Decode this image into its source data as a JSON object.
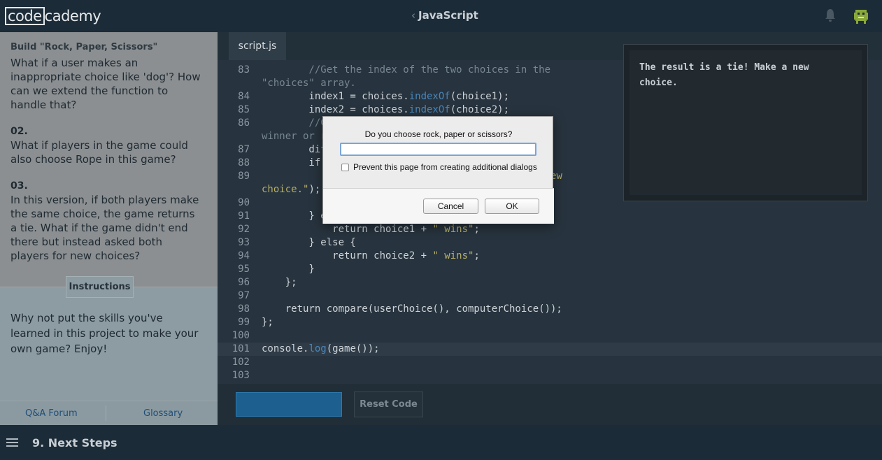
{
  "topbar": {
    "logo_part1": "code",
    "logo_part2": "cademy",
    "breadcrumb": "JavaScript"
  },
  "lesson": {
    "title": "Build \"Rock, Paper, Scissors\"",
    "intro": "What if a user makes an inappropriate choice like 'dog'? How can we extend the function to handle that?",
    "items": [
      {
        "num": "02.",
        "text": "What if players in the game could also choose Rope in this game?"
      },
      {
        "num": "03.",
        "text": "In this version, if both players make the same choice, the game returns a tie. What if the game didn't end there but instead asked both players for new choices?"
      }
    ],
    "instructions_tab": "Instructions",
    "instructions_text": "Why not put the skills you've learned in this project to make your own game? Enjoy!",
    "footer_links": [
      "Q&A Forum",
      "Glossary"
    ]
  },
  "editor": {
    "file_tab": "script.js",
    "reset_label": "Reset Code"
  },
  "code_lines": [
    {
      "n": "83",
      "parts": [
        [
          "cm",
          "        //Get the index of the two choices in the"
        ]
      ]
    },
    {
      "n": "",
      "parts": [
        [
          "cm",
          "\"choices\" array."
        ]
      ]
    },
    {
      "n": "84",
      "parts": [
        [
          "kw",
          "        index1 = choices."
        ],
        [
          "fn",
          "indexOf"
        ],
        [
          "kw",
          "(choice1);"
        ]
      ]
    },
    {
      "n": "85",
      "parts": [
        [
          "kw",
          "        index2 = choices."
        ],
        [
          "fn",
          "indexOf"
        ],
        [
          "kw",
          "(choice2);"
        ]
      ]
    },
    {
      "n": "86",
      "parts": [
        [
          "cm",
          "        //Check the difference to determine the"
        ]
      ]
    },
    {
      "n": "",
      "parts": [
        [
          "cm",
          "winner or result"
        ]
      ]
    },
    {
      "n": "87",
      "parts": [
        [
          "kw",
          "        dif = index2 - index1;"
        ]
      ]
    },
    {
      "n": "88",
      "parts": [
        [
          "kw",
          "        if(dif === 0) {"
        ]
      ]
    },
    {
      "n": "89",
      "parts": [
        [
          "kw",
          "            return "
        ],
        [
          "st",
          "\"The result is a tie! Make a new"
        ]
      ]
    },
    {
      "n": "",
      "parts": [
        [
          "st",
          "choice.\""
        ],
        [
          "kw",
          ");"
        ]
      ]
    },
    {
      "n": "90",
      "parts": [
        [
          "kw",
          "        "
        ]
      ]
    },
    {
      "n": "91",
      "parts": [
        [
          "kw",
          "        } else if (dif < 0) {"
        ]
      ]
    },
    {
      "n": "92",
      "parts": [
        [
          "kw",
          "            return choice1 + "
        ],
        [
          "st",
          "\" wins\""
        ],
        [
          "kw",
          ";"
        ]
      ]
    },
    {
      "n": "93",
      "parts": [
        [
          "kw",
          "        } else {"
        ]
      ]
    },
    {
      "n": "94",
      "parts": [
        [
          "kw",
          "            return choice2 + "
        ],
        [
          "st",
          "\" wins\""
        ],
        [
          "kw",
          ";"
        ]
      ]
    },
    {
      "n": "95",
      "parts": [
        [
          "kw",
          "        }"
        ]
      ]
    },
    {
      "n": "96",
      "parts": [
        [
          "kw",
          "    };"
        ]
      ]
    },
    {
      "n": "97",
      "parts": [
        [
          "kw",
          ""
        ]
      ]
    },
    {
      "n": "98",
      "parts": [
        [
          "kw",
          "    return compare(userChoice(), computerChoice());"
        ]
      ]
    },
    {
      "n": "99",
      "parts": [
        [
          "kw",
          "};"
        ]
      ]
    },
    {
      "n": "100",
      "parts": [
        [
          "kw",
          ""
        ]
      ]
    },
    {
      "n": "101",
      "parts": [
        [
          "kw",
          "console."
        ],
        [
          "fn",
          "log"
        ],
        [
          "kw",
          "(game());"
        ]
      ]
    },
    {
      "n": "102",
      "parts": [
        [
          "kw",
          ""
        ]
      ]
    },
    {
      "n": "103",
      "parts": [
        [
          "kw",
          ""
        ]
      ]
    }
  ],
  "console_output": "The result is a tie! Make a new choice.",
  "footer": {
    "step": "9. Next Steps"
  },
  "dialog": {
    "message": "Do you choose rock, paper or scissors?",
    "input_value": "",
    "checkbox_label": "Prevent this page from creating additional dialogs",
    "cancel_label": "Cancel",
    "ok_label": "OK"
  }
}
